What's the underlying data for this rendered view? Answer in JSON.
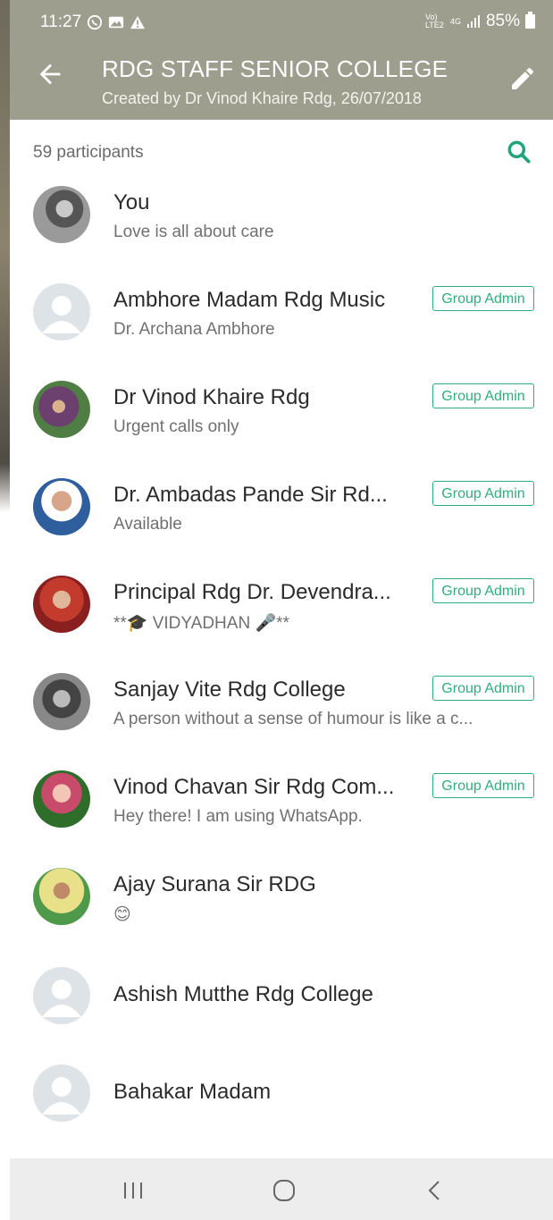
{
  "status_bar": {
    "time": "11:27",
    "net_small": "Vo) LTE2",
    "net_4g": "4G",
    "battery": "85%",
    "icons": [
      "whatsapp-icon",
      "gallery-icon",
      "warning-icon",
      "signal-icon",
      "battery-icon"
    ]
  },
  "header": {
    "title": "RDG STAFF SENIOR COLLEGE",
    "subtitle": "Created by Dr Vinod Khaire Rdg, 26/07/2018"
  },
  "participants_count": "59 participants",
  "participants": [
    {
      "name": "You",
      "status": "Love is all about care",
      "admin": ""
    },
    {
      "name": "Ambhore Madam Rdg Music",
      "status": "Dr. Archana Ambhore",
      "admin": "Group Admin"
    },
    {
      "name": "Dr Vinod Khaire Rdg",
      "status": "Urgent calls only",
      "admin": "Group Admin"
    },
    {
      "name": "Dr. Ambadas Pande Sir Rd...",
      "status": "Available",
      "admin": "Group Admin"
    },
    {
      "name": "Principal Rdg Dr. Devendra...",
      "status": "**🎓 VIDYADHAN 🎤**",
      "admin": "Group Admin"
    },
    {
      "name": "Sanjay Vite Rdg College",
      "status": "A person without a sense of humour is like a c...",
      "admin": "Group Admin"
    },
    {
      "name": "Vinod Chavan Sir Rdg Com...",
      "status": "Hey there! I am using WhatsApp.",
      "admin": "Group Admin"
    },
    {
      "name": "Ajay Surana Sir RDG",
      "status": "😊",
      "admin": ""
    },
    {
      "name": "Ashish Mutthe Rdg College",
      "status": "",
      "admin": ""
    },
    {
      "name": "Bahakar Madam",
      "status": "",
      "admin": ""
    }
  ],
  "colors": {
    "header_bg": "#9e9e8f",
    "accent": "#2fae7d"
  }
}
